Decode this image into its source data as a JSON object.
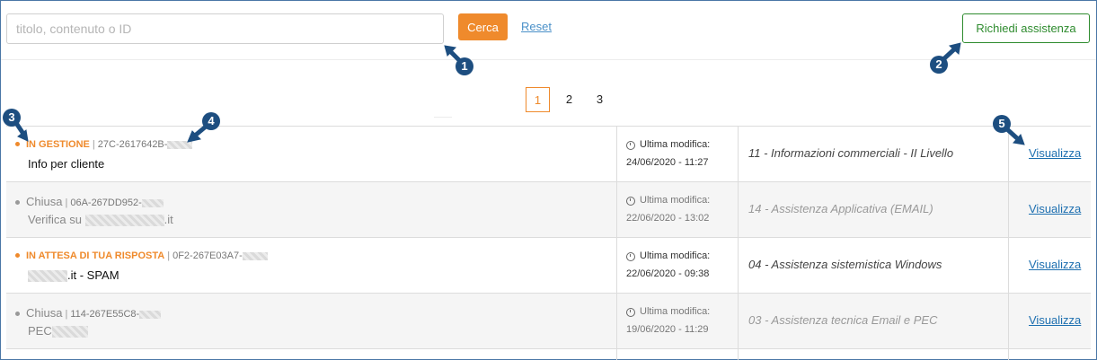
{
  "search": {
    "placeholder": "titolo, contenuto o ID",
    "value": "",
    "submit_label": "Cerca",
    "reset_label": "Reset"
  },
  "header": {
    "assist_label": "Richiedi assistenza"
  },
  "pagination": {
    "pages": [
      "1",
      "2",
      "3"
    ],
    "current": "1"
  },
  "tickets": [
    {
      "status": "IN GESTIONE",
      "status_color": "#ef8a2c",
      "id": "27C-2617642B-",
      "title": "Info per cliente",
      "title_suffix": "",
      "modified_label": "Ultima modifica:",
      "modified": "24/06/2020 - 11:27",
      "category": "11 - Informazioni commerciali - II Livello",
      "action": "Visualizza"
    },
    {
      "status": "Chiusa",
      "status_color": "#999999",
      "id": "06A-267DD952-",
      "title": "Verifica su",
      "title_suffix": ".it",
      "modified_label": "Ultima modifica:",
      "modified": "22/06/2020 - 13:02",
      "category": "14 - Assistenza Applicativa (EMAIL)",
      "action": "Visualizza"
    },
    {
      "status": "IN ATTESA DI TUA RISPOSTA",
      "status_color": "#ef8a2c",
      "id": "0F2-267E03A7-",
      "title": "",
      "title_suffix": ".it - SPAM",
      "modified_label": "Ultima modifica:",
      "modified": "22/06/2020 - 09:38",
      "category": "04 - Assistenza sistemistica Windows",
      "action": "Visualizza"
    },
    {
      "status": "Chiusa",
      "status_color": "#999999",
      "id": "114-267E55C8-",
      "title": "PEC",
      "title_suffix": "",
      "modified_label": "Ultima modifica:",
      "modified": "19/06/2020 - 11:29",
      "category": "03 - Assistenza tecnica Email e PEC",
      "action": "Visualizza"
    }
  ],
  "annotations": [
    "1",
    "2",
    "3",
    "4",
    "5"
  ],
  "colors": {
    "accent": "#ef8a2c",
    "assist": "#2e8b2e",
    "link": "#1d6fb0",
    "marker": "#1d4e80"
  }
}
